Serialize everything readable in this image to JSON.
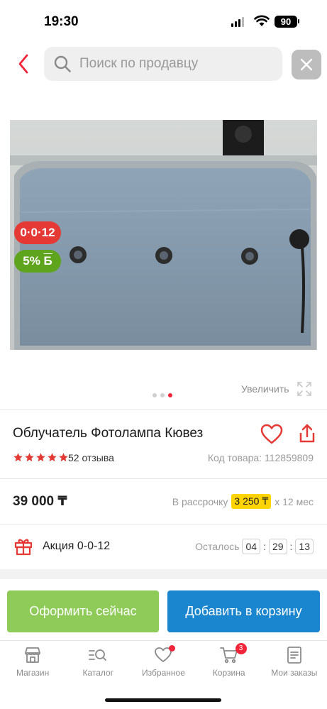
{
  "status_bar": {
    "time": "19:30",
    "battery": "90"
  },
  "search": {
    "placeholder": "Поиск по продавцу"
  },
  "product": {
    "badges": {
      "promo": "0·0·12",
      "bonus": "5%",
      "bonus_currency": "Б"
    },
    "zoom_label": "Увеличить",
    "gallery": {
      "count": 3,
      "active": 3
    },
    "title": "Облучатель Фотолампа Кювез",
    "rating": 5,
    "reviews": "52 отзыва",
    "sku": "Код товара: 112859809",
    "price": "39 000 ₸",
    "installment": {
      "prefix": "В рассрочку",
      "amount": "3 250 ₸",
      "term": "х 12 мес"
    },
    "promo": {
      "label": "Акция 0-0-12",
      "remaining_label": "Осталось",
      "hours": "04",
      "minutes": "29",
      "seconds": "13"
    }
  },
  "actions": {
    "checkout": "Оформить сейчас",
    "add_to_cart": "Добавить в корзину"
  },
  "tabbar": {
    "items": [
      {
        "label": "Магазин",
        "icon": "store-icon"
      },
      {
        "label": "Каталог",
        "icon": "catalog-search-icon"
      },
      {
        "label": "Избранное",
        "icon": "heart-icon",
        "dot": true
      },
      {
        "label": "Корзина",
        "icon": "cart-icon",
        "badge": "3"
      },
      {
        "label": "Мои заказы",
        "icon": "orders-icon"
      }
    ]
  },
  "colors": {
    "accent": "#f0253a",
    "green_button": "#8fcb59",
    "blue_button": "#1a86cf",
    "highlight": "#ffd400"
  }
}
